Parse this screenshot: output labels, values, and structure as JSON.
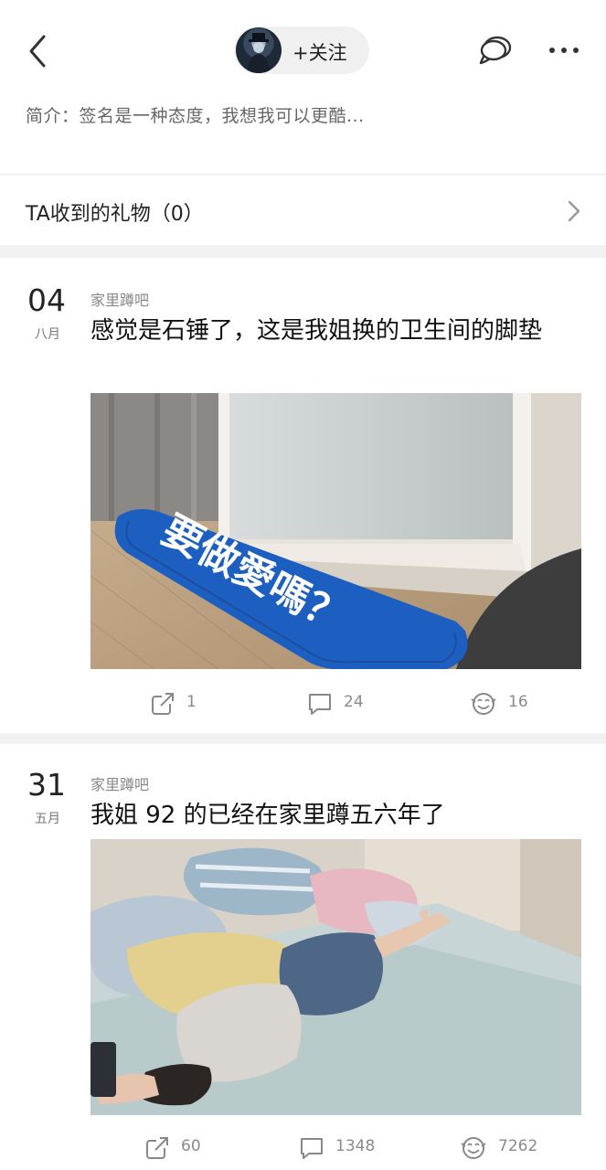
{
  "header": {
    "follow_label": "+关注"
  },
  "profile": {
    "intro": "简介：签名是一种态度，我想我可以更酷..."
  },
  "gifts": {
    "label": "TA收到的礼物（0）"
  },
  "posts": [
    {
      "day": "04",
      "month": "八月",
      "forum": "家里蹲吧",
      "title": "感觉是石锤了，这是我姐换的卫生间的脚垫",
      "mat_text": "要做愛嗎？",
      "shares": "1",
      "comments": "24",
      "likes": "16"
    },
    {
      "day": "31",
      "month": "五月",
      "forum": "家里蹲吧",
      "title": "我姐 92 的已经在家里蹲五六年了",
      "shares": "60",
      "comments": "1348",
      "likes": "7262"
    }
  ],
  "icons": {
    "back": "back-arrow-icon",
    "chat": "chat-bubble-icon",
    "more": "more-dots-icon",
    "share": "share-icon",
    "comment": "comment-icon",
    "like": "like-face-icon"
  }
}
